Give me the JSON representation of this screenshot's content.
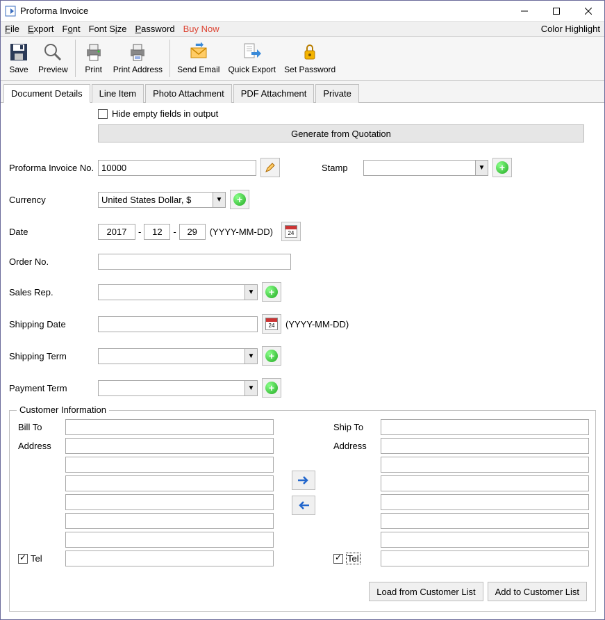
{
  "window": {
    "title": "Proforma Invoice"
  },
  "menu": {
    "file": "File",
    "export": "Export",
    "font": "Font",
    "fontsize": "Font Size",
    "password": "Password",
    "buynow": "Buy Now",
    "colorhighlight": "Color Highlight"
  },
  "toolbar": {
    "save": "Save",
    "preview": "Preview",
    "print": "Print",
    "print_address": "Print Address",
    "send_email": "Send Email",
    "quick_export": "Quick Export",
    "set_password": "Set Password"
  },
  "tabs": {
    "document_details": "Document Details",
    "line_item": "Line Item",
    "photo_attachment": "Photo Attachment",
    "pdf_attachment": "PDF Attachment",
    "private": "Private"
  },
  "form": {
    "hide_empty_label": "Hide empty fields in output",
    "hide_empty_checked": false,
    "generate_from_quotation": "Generate from Quotation",
    "invoice_no_label": "Proforma Invoice No.",
    "invoice_no_value": "10000",
    "stamp_label": "Stamp",
    "stamp_value": "",
    "currency_label": "Currency",
    "currency_value": "United States Dollar, $",
    "date_label": "Date",
    "date_year": "2017",
    "date_month": "12",
    "date_day": "29",
    "date_format_hint": "(YYYY-MM-DD)",
    "order_no_label": "Order No.",
    "order_no_value": "",
    "sales_rep_label": "Sales Rep.",
    "sales_rep_value": "",
    "shipping_date_label": "Shipping Date",
    "shipping_date_value": "",
    "shipping_date_hint": "(YYYY-MM-DD)",
    "shipping_term_label": "Shipping Term",
    "shipping_term_value": "",
    "payment_term_label": "Payment Term",
    "payment_term_value": ""
  },
  "customer": {
    "legend": "Customer Information",
    "bill_to_label": "Bill To",
    "ship_to_label": "Ship To",
    "address_label": "Address",
    "tel_label": "Tel",
    "bill_to": "",
    "ship_to": "",
    "bill_addr": [
      "",
      "",
      "",
      "",
      "",
      ""
    ],
    "ship_addr": [
      "",
      "",
      "",
      "",
      "",
      ""
    ],
    "bill_tel_checked": true,
    "ship_tel_checked": true,
    "bill_tel": "",
    "ship_tel": "",
    "load_btn": "Load from Customer List",
    "add_btn": "Add to Customer List"
  }
}
